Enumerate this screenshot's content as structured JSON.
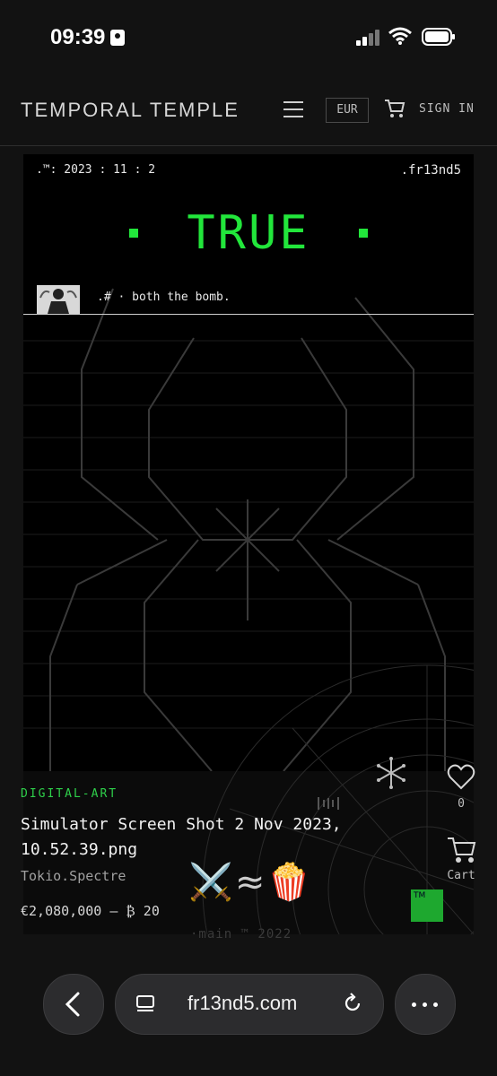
{
  "status": {
    "time": "09:39"
  },
  "header": {
    "brand": "TEMPORAL TEMPLE",
    "currency": "EUR",
    "signin": "SIGN IN"
  },
  "artwork": {
    "date_stamp": ".™: 2023 : 11 : 2",
    "handle": ".fr13nd5",
    "headline": "TRUE",
    "caption": ".# · both the bomb.",
    "headline_color": "#22e63b"
  },
  "product": {
    "category": "DIGITAL-ART",
    "title": "Simulator Screen Shot 2 Nov 2023, 10.52.39.png",
    "artist": "Tokio.Spectre",
    "price": "€2,080,000 – ₿ 20",
    "emojis": [
      "⚔️",
      "≈",
      "🍿"
    ],
    "like_count": "0",
    "cart_label": "Cart",
    "tm_badge": "TM",
    "footer_mark": "·main ™ 2022"
  },
  "browser": {
    "url": "fr13nd5.com"
  },
  "icons": [
    "id-badge-icon",
    "signal-icon",
    "wifi-icon",
    "battery-icon",
    "menu-icon",
    "cart-icon",
    "heart-icon",
    "back-icon",
    "reader-icon",
    "reload-icon",
    "more-icon"
  ]
}
